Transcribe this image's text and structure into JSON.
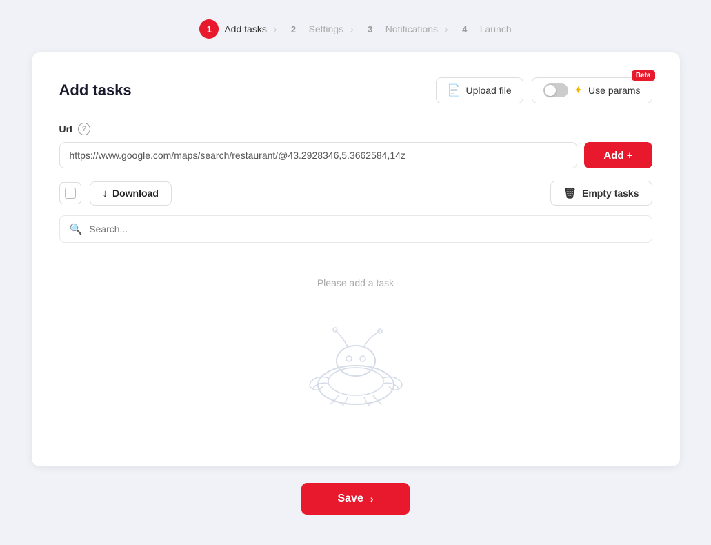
{
  "stepper": {
    "steps": [
      {
        "number": "1",
        "label": "Add tasks",
        "active": true
      },
      {
        "number": "2",
        "label": "Settings",
        "active": false
      },
      {
        "number": "3",
        "label": "Notifications",
        "active": false
      },
      {
        "number": "4",
        "label": "Launch",
        "active": false
      }
    ]
  },
  "card": {
    "title": "Add tasks",
    "upload_file_label": "Upload file",
    "beta_badge": "Beta",
    "use_params_label": "Use params",
    "url_label": "Url",
    "url_placeholder": "https://www.google.com/maps/search/restaurant/@43.2928346,5.3662584,14z",
    "url_value": "https://www.google.com/maps/search/restaurant/@43.2928346,5.3662584,14z",
    "add_button_label": "Add +",
    "download_label": "Download",
    "empty_tasks_label": "Empty tasks",
    "search_placeholder": "Search...",
    "empty_state_text": "Please add a task"
  },
  "footer": {
    "save_label": "Save",
    "chevron": "›"
  },
  "icons": {
    "file": "🗋",
    "star": "✦",
    "download_arrow": "↓",
    "trash": "🗑",
    "search": "🔍",
    "chevron_right": "›"
  }
}
